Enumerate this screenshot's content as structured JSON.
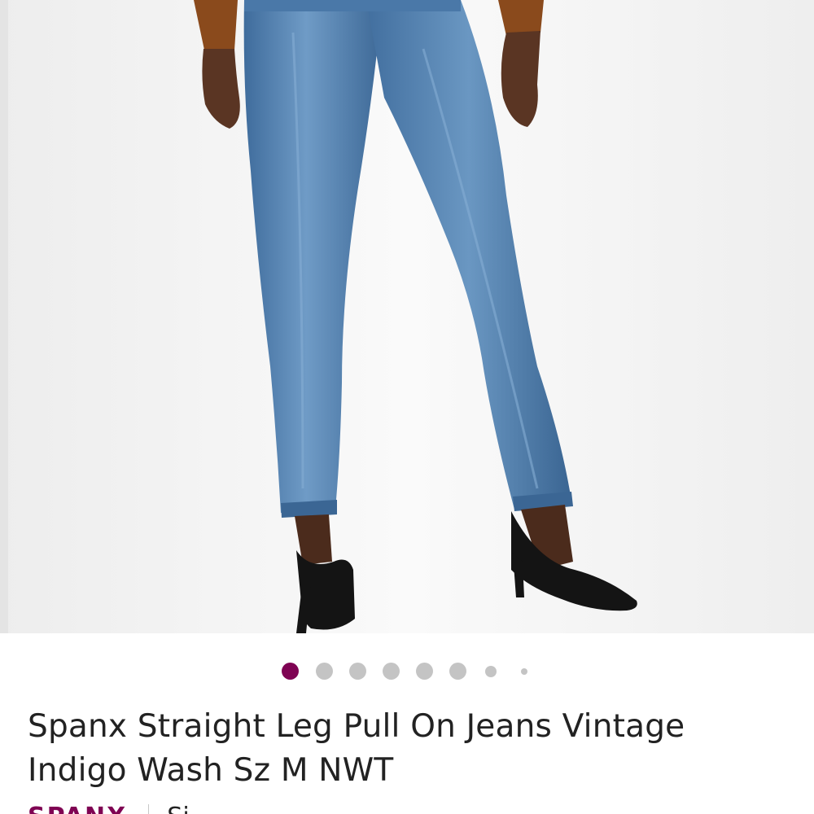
{
  "listing": {
    "title": "Spanx Straight Leg Pull On Jeans Vintage Indigo Wash Sz M NWT",
    "brand": "SPANX",
    "size_label": "Si"
  },
  "carousel": {
    "total_dots": 8,
    "active_index": 0
  },
  "colors": {
    "accent": "#7f0353",
    "denim": "#4f7fae",
    "dot_inactive": "#c4c4c4"
  }
}
